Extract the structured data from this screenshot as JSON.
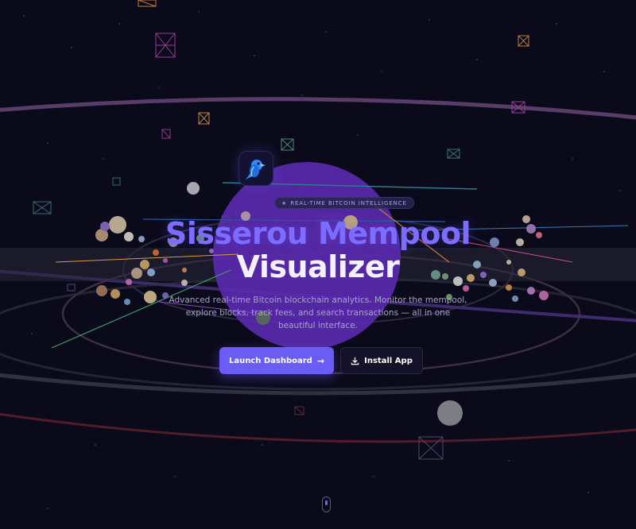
{
  "hero": {
    "badge_icon": "star",
    "badge_text": "REAL-TIME BITCOIN INTELLIGENCE",
    "title_line1": "Sisserou Mempool",
    "title_line2": "Visualizer",
    "subtitle": "Advanced real-time Bitcoin blockchain analytics. Monitor the mempool, explore blocks, track fees, and search transactions — all in one beautiful interface.",
    "primary_button": {
      "label": "Launch Dashboard",
      "icon": "arrow-right-icon"
    },
    "secondary_button": {
      "label": "Install App",
      "icon": "download-icon"
    }
  },
  "logo": {
    "icon": "parrot-logo-icon"
  },
  "colors": {
    "background": "#0b0a1a",
    "accent": "#6a5cf5",
    "title_accent": "#7c6cff",
    "planet": "#5b2ab0"
  }
}
